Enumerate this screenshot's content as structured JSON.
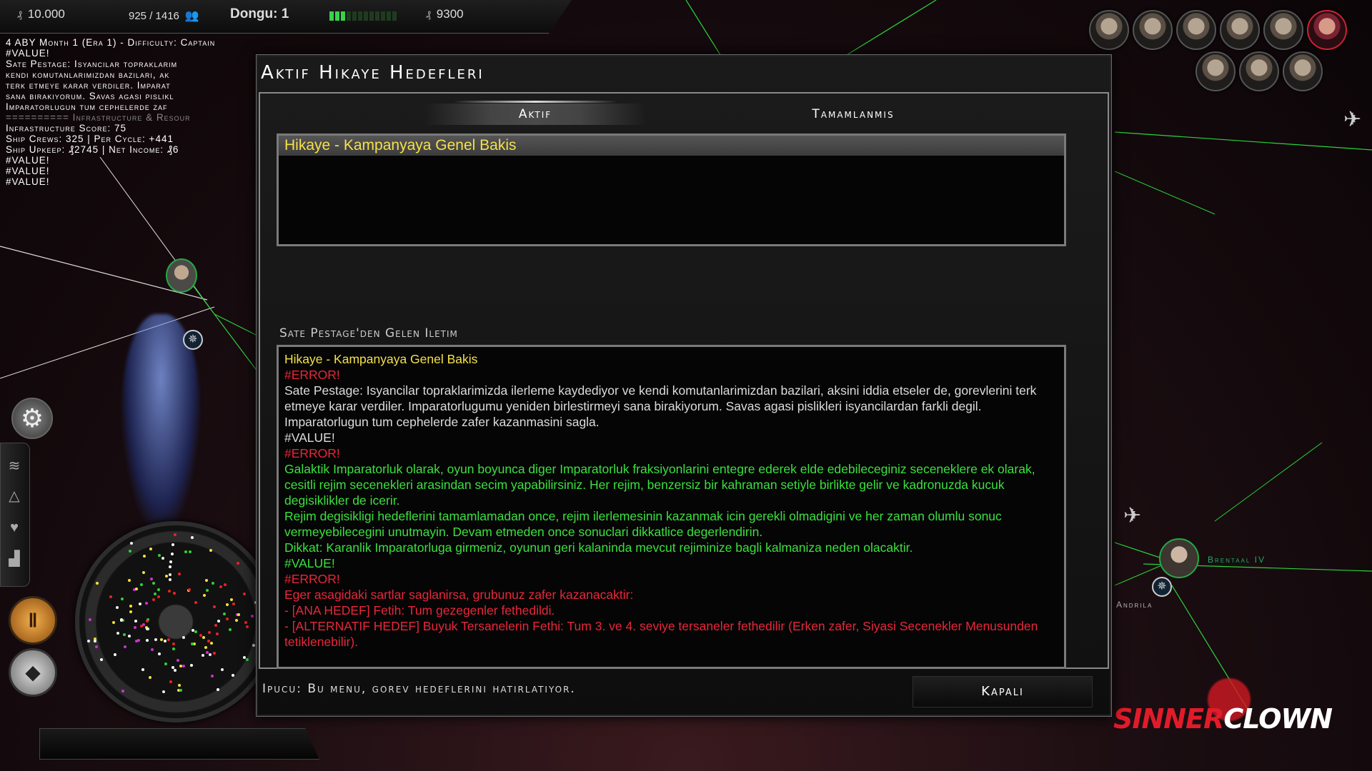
{
  "topbar": {
    "credits": "10.000",
    "population": "925 / 1416",
    "turn_label": "Dongu: 1",
    "production_filled": 3,
    "production_total": 12,
    "income": "9300"
  },
  "log": {
    "lines": [
      {
        "text": "4 ABY Month 1 (Era 1) - Difficulty: Captain",
        "dim": false
      },
      {
        "text": "#VALUE!",
        "dim": false
      },
      {
        "text": "Sate Pestage: Isyancilar topraklarim",
        "dim": false
      },
      {
        "text": "kendi komutanlarimizdan bazilari, ak",
        "dim": false
      },
      {
        "text": "terk etmeye karar verdiler. Imparat",
        "dim": false
      },
      {
        "text": "sana birakiyorum. Savas agasi pislikl",
        "dim": false
      },
      {
        "text": "Imparatorlugun tum cephelerde zaf",
        "dim": false
      },
      {
        "text": "========== Infrastructure & Resour",
        "dim": true
      },
      {
        "text": "Infrastructure Score: 75",
        "dim": false
      },
      {
        "text": "Ship Crews: 325 | Per Cycle: +441",
        "dim": false
      },
      {
        "text": "Ship Upkeep: ₰2745 | Net Income: ₰6",
        "dim": false
      },
      {
        "text": "#VALUE!",
        "dim": false
      },
      {
        "text": "#VALUE!",
        "dim": false
      },
      {
        "text": "#VALUE!",
        "dim": false
      }
    ]
  },
  "map": {
    "planet_1": "Brentaal IV",
    "planet_2": "Andrila"
  },
  "dialog": {
    "title": "Aktif Hikaye Hedefleri",
    "tab_active": "Aktif",
    "tab_completed": "Tamamlanmis",
    "objectives": [
      "Hikaye - Kampanyaya Genel Bakis"
    ],
    "message_label": "Sate Pestage'den Gelen Iletim",
    "message_lines": [
      {
        "text": "Hikaye - Kampanyaya Genel Bakis",
        "color": "yellow"
      },
      {
        "text": "#ERROR!",
        "color": "red"
      },
      {
        "text": "Sate Pestage: Isyancilar topraklarimizda ilerleme kaydediyor ve kendi komutanlarimizdan bazilari, aksini iddia etseler de, gorevlerini terk etmeye karar verdiler. Imparatorlugumu yeniden birlestirmeyi sana birakiyorum. Savas agasi pislikleri isyancilardan farkli degil. Imparatorlugun tum cephelerde zafer kazanmasini sagla.",
        "color": "white"
      },
      {
        "text": "#VALUE!",
        "color": "white"
      },
      {
        "text": "#ERROR!",
        "color": "red"
      },
      {
        "text": "Galaktik Imparatorluk olarak, oyun boyunca diger Imparatorluk fraksiyonlarini entegre ederek elde edebileceginiz seceneklere ek olarak, cesitli rejim secenekleri arasindan secim yapabilirsiniz. Her rejim, benzersiz bir kahraman setiyle birlikte gelir ve kadronuzda kucuk degisiklikler de icerir.",
        "color": "green"
      },
      {
        "text": "Rejim degisikligi hedeflerini tamamlamadan once, rejim ilerlemesinin kazanmak icin gerekli olmadigini ve her zaman olumlu sonuc vermeyebilecegini unutmayin. Devam etmeden once sonuclari dikkatlice degerlendirin.",
        "color": "green"
      },
      {
        "text": "Dikkat: Karanlik Imparatorluga girmeniz, oyunun geri kalaninda mevcut rejiminize bagli kalmaniza neden olacaktir.",
        "color": "green"
      },
      {
        "text": "#VALUE!",
        "color": "green"
      },
      {
        "text": "#ERROR!",
        "color": "red"
      },
      {
        "text": "Eger asagidaki sartlar saglanirsa, grubunuz zafer kazanacaktir:",
        "color": "red"
      },
      {
        "text": "- [ANA HEDEF] Fetih: Tum gezegenler fethedildi.",
        "color": "red"
      },
      {
        "text": "- [ALTERNATIF HEDEF] Buyuk Tersanelerin Fethi: Tum 3. ve 4. seviye tersaneler fethedilir (Erken zafer, Siyasi Secenekler Menusunden tetiklenebilir).",
        "color": "red"
      }
    ],
    "hint": "Ipucu: Bu menu, gorev hedeflerini hatirlatiyor.",
    "close_label": "Kapali"
  },
  "logo": {
    "part1": "SINNER",
    "part2": "CLOWN"
  },
  "colors": {
    "yellow": "#f5e04a",
    "red": "#e8263a",
    "green": "#3be03f",
    "white": "#dcdcdc"
  }
}
